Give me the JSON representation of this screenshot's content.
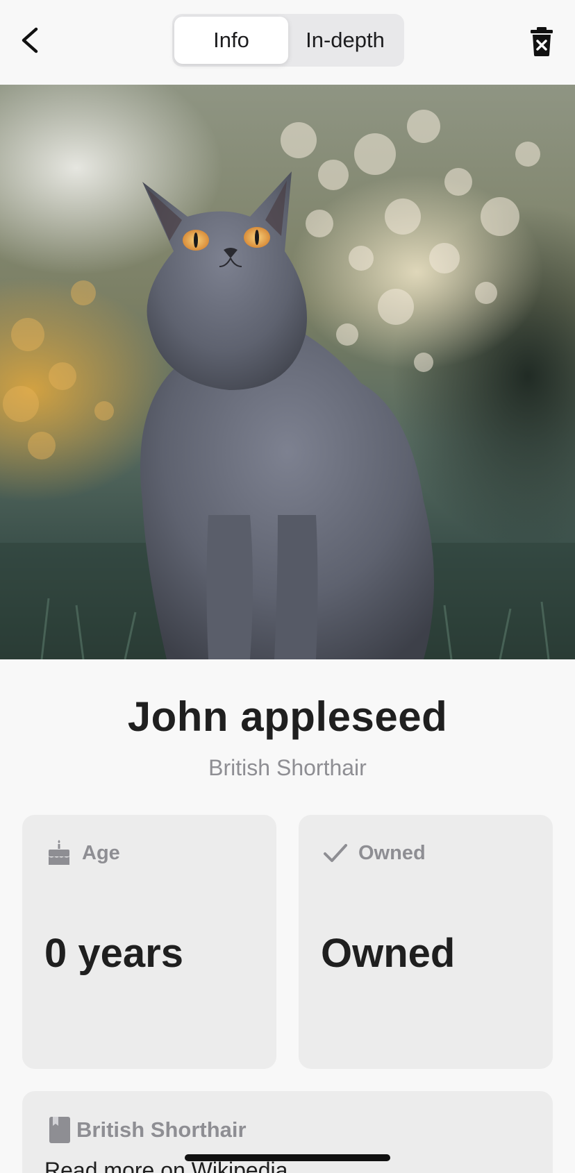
{
  "header": {
    "tabs": [
      {
        "label": "Info",
        "selected": true
      },
      {
        "label": "In-depth",
        "selected": false
      }
    ],
    "back_icon": "chevron-left-icon",
    "delete_icon": "trash-icon"
  },
  "pet": {
    "name": "John appleseed",
    "breed": "British Shorthair"
  },
  "cards": {
    "age": {
      "title": "Age",
      "value": "0 years",
      "icon": "cake-icon"
    },
    "owned": {
      "title": "Owned",
      "value": "Owned",
      "icon": "checkmark-icon"
    }
  },
  "wiki": {
    "title": "British Shorthair",
    "link_text": "Read more on Wikipedia",
    "icon": "book-icon"
  },
  "colors": {
    "background": "#f8f8f8",
    "card": "#ececec",
    "muted_text": "#8e8e93",
    "primary_text": "#1f1f1f"
  }
}
